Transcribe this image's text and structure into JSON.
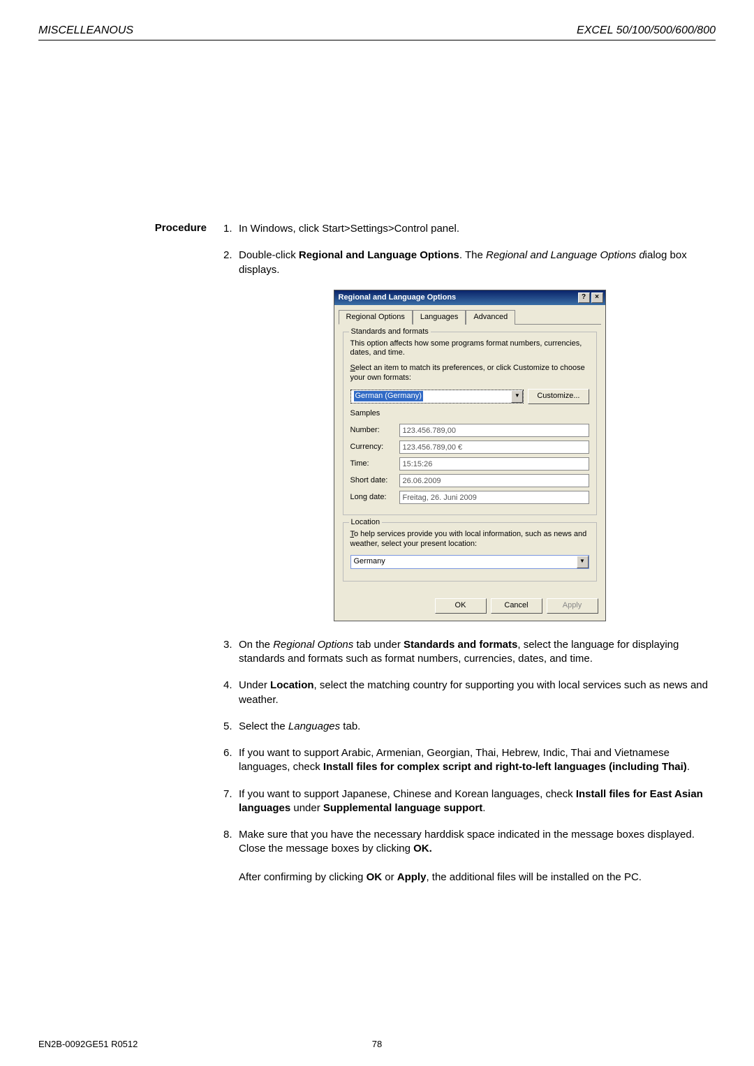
{
  "header": {
    "left": "MISCELLEANOUS",
    "right": "EXCEL 50/100/500/600/800"
  },
  "procedure_label": "Procedure",
  "steps": {
    "s1": "In Windows, click Start>Settings>Control panel.",
    "s2_a": "Double-click ",
    "s2_b": "Regional and Language Options",
    "s2_c": ". The ",
    "s2_d": "Regional and Language Options d",
    "s2_e": "ialog box displays.",
    "s3_a": "On the ",
    "s3_b": "Regional Options",
    "s3_c": " tab under ",
    "s3_d": "Standards and formats",
    "s3_e": ", select the language for displaying standards and formats such as format numbers, currencies, dates, and time.",
    "s4_a": "Under ",
    "s4_b": "Location",
    "s4_c": ", select the matching country for supporting you with local services such as news and weather.",
    "s5_a": "Select the ",
    "s5_b": "Languages",
    "s5_c": " tab.",
    "s6_a": "If you want to support Arabic, Armenian, Georgian, Thai, Hebrew, Indic, Thai and Vietnamese languages, check ",
    "s6_b": "Install files for complex script and right-to-left languages (including Thai)",
    "s6_c": ".",
    "s7_a": "If you want to support Japanese, Chinese and Korean languages, check ",
    "s7_b": "Install files for East Asian languages",
    "s7_c": " under ",
    "s7_d": "Supplemental language support",
    "s7_e": ".",
    "s8_a": "Make sure that you have the necessary harddisk space indicated in the message boxes displayed. Close the message boxes by clicking ",
    "s8_b": "OK.",
    "s8_after_a": "After confirming by clicking ",
    "s8_after_b": "OK",
    "s8_after_c": " or ",
    "s8_after_d": "Apply",
    "s8_after_e": ", the additional files will be installed on the PC."
  },
  "dialog": {
    "title": "Regional and Language Options",
    "help_btn": "?",
    "close_btn": "×",
    "tabs": [
      "Regional Options",
      "Languages",
      "Advanced"
    ],
    "active_tab": 0,
    "group1": {
      "legend": "Standards and formats",
      "text1": "This option affects how some programs format numbers, currencies, dates, and time.",
      "text2_a": "S",
      "text2_b": "elect an item to match its preferences, or click Customize to choose your own formats:",
      "format_value": "German (Germany)",
      "customize_btn": "Customize...",
      "samples_label": "Samples",
      "samples": [
        {
          "label": "Number:",
          "value": "123.456.789,00"
        },
        {
          "label": "Currency:",
          "value": "123.456.789,00 €"
        },
        {
          "label": "Time:",
          "value": "15:15:26"
        },
        {
          "label": "Short date:",
          "value": "26.06.2009"
        },
        {
          "label": "Long date:",
          "value": "Freitag, 26. Juni 2009"
        }
      ]
    },
    "group2": {
      "legend": "Location",
      "text_a": "T",
      "text_b": "o help services provide you with local information, such as news and weather, select your present location:",
      "location_value": "Germany"
    },
    "buttons": {
      "ok": "OK",
      "cancel": "Cancel",
      "apply": "Apply"
    }
  },
  "footer": {
    "docnum": "EN2B-0092GE51 R0512",
    "pagenum": "78"
  }
}
